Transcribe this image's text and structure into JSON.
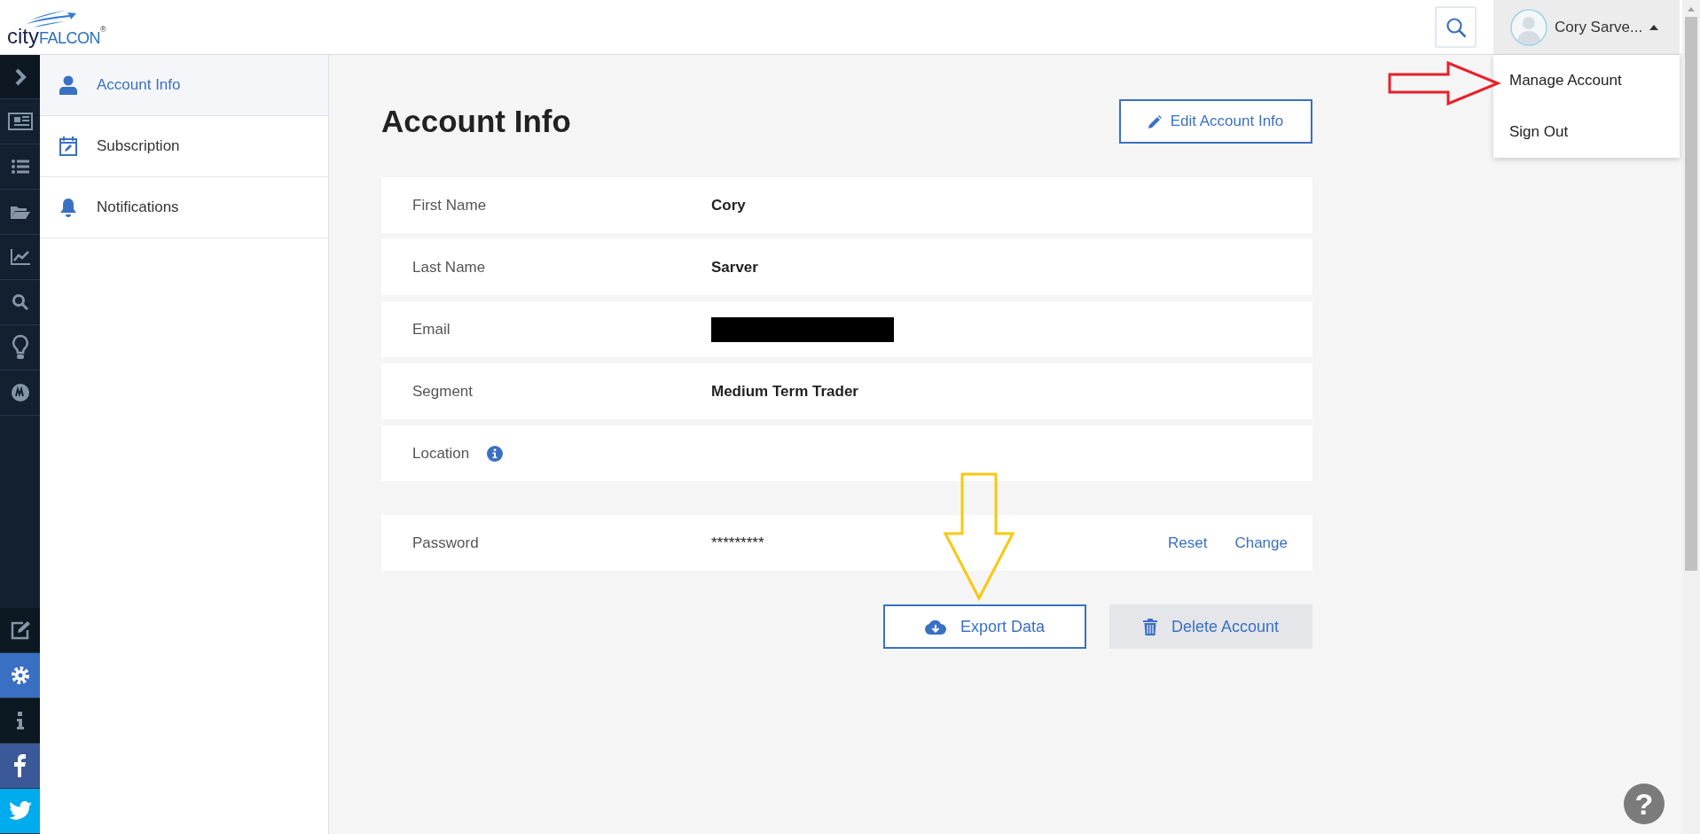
{
  "header": {
    "logo": {
      "left": "city",
      "right": "FALCON",
      "mark": "®"
    },
    "user": {
      "name": "Cory Sarve...",
      "expanded": true
    },
    "user_menu": [
      {
        "label": "Manage Account"
      },
      {
        "label": "Sign Out"
      }
    ]
  },
  "rail": {
    "top": [
      {
        "kind": "expand",
        "selected": false
      },
      {
        "kind": "news",
        "selected": false
      },
      {
        "kind": "list",
        "selected": false
      },
      {
        "kind": "folder",
        "selected": false
      },
      {
        "kind": "chart",
        "selected": false
      },
      {
        "kind": "search",
        "selected": false
      },
      {
        "kind": "bulb",
        "selected": false
      },
      {
        "kind": "badge",
        "selected": false
      }
    ],
    "bottom": [
      {
        "kind": "edit",
        "selected": false
      },
      {
        "kind": "gear",
        "selected": true
      },
      {
        "kind": "info",
        "selected": false
      },
      {
        "kind": "facebook",
        "selected": false
      },
      {
        "kind": "twitter",
        "selected": false
      }
    ]
  },
  "settings_nav": [
    {
      "label": "Account Info",
      "kind": "user",
      "selected": true
    },
    {
      "label": "Subscription",
      "kind": "calendar",
      "selected": false
    },
    {
      "label": "Notifications",
      "kind": "bell",
      "selected": false
    }
  ],
  "page": {
    "title": "Account Info",
    "edit_button": "Edit Account Info",
    "fields": [
      {
        "label": "First Name",
        "value": "Cory"
      },
      {
        "label": "Last Name",
        "value": "Sarver"
      },
      {
        "label": "Email",
        "redacted": true
      },
      {
        "label": "Segment",
        "value": "Medium Term Trader"
      },
      {
        "label": "Location",
        "info": true
      }
    ],
    "password": {
      "label": "Password",
      "value": "*********",
      "actions": [
        "Reset",
        "Change"
      ]
    },
    "buttons": [
      {
        "kind": "export",
        "label": "Export Data"
      },
      {
        "kind": "delete",
        "label": "Delete Account"
      }
    ]
  },
  "annotations": [
    {
      "kind": "right"
    },
    {
      "kind": "down"
    }
  ],
  "help": "?"
}
